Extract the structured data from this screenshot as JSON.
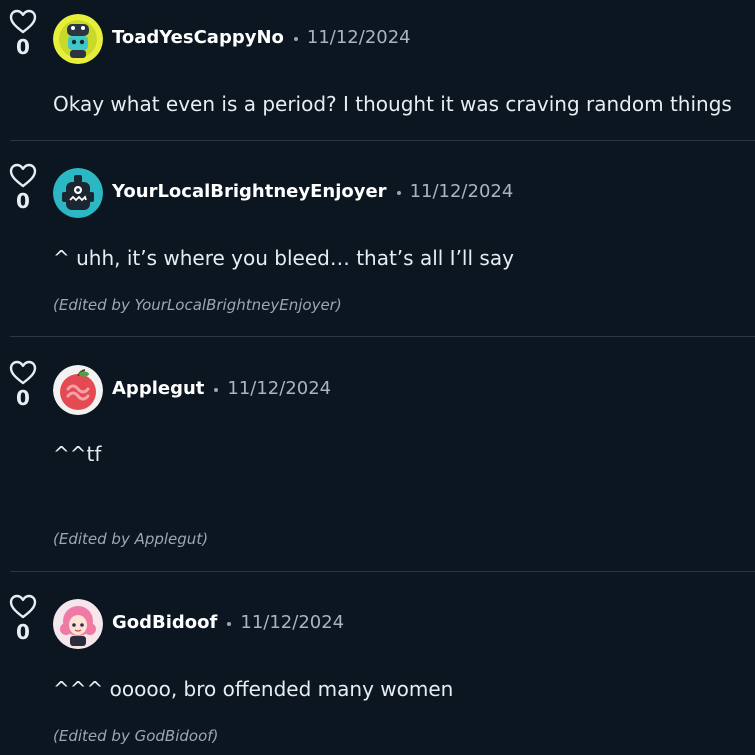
{
  "comments": [
    {
      "votes": "0",
      "username": "ToadYesCappyNo",
      "date": "11/12/2024",
      "text": "Okay what even is a period? I thought it was craving random things",
      "edited": ""
    },
    {
      "votes": "0",
      "username": "YourLocalBrightneyEnjoyer",
      "date": "11/12/2024",
      "text": "^ uhh, it’s where you bleed… that’s all I’ll say",
      "edited": "(Edited by YourLocalBrightneyEnjoyer)"
    },
    {
      "votes": "0",
      "username": "Applegut",
      "date": "11/12/2024",
      "text": "^^tf",
      "edited": "(Edited by Applegut)"
    },
    {
      "votes": "0",
      "username": "GodBidoof",
      "date": "11/12/2024",
      "text": "^^^ ooooo, bro offended many women",
      "edited": "(Edited by GodBidoof)"
    }
  ],
  "icons": {
    "like": "heart-outline-icon"
  },
  "colors": {
    "background": "#0b1621",
    "divider": "#2a3744",
    "muted": "#9aa7b4"
  }
}
